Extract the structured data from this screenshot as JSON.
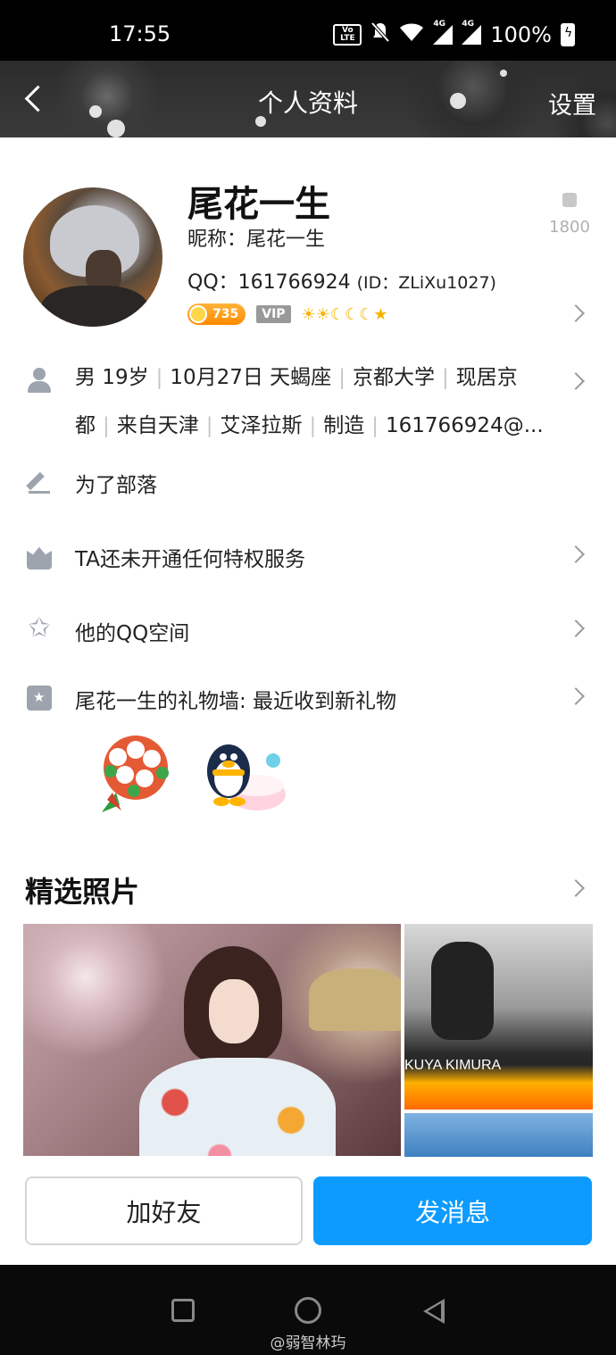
{
  "status_bar": {
    "time": "17:55",
    "volte_label": "Vo LTE",
    "network_1": "4G",
    "network_2": "4G",
    "battery": "100%"
  },
  "header": {
    "title": "个人资料",
    "settings_label": "设置"
  },
  "profile": {
    "display_name": "尾花一生",
    "nickname_line": "昵称：尾花一生",
    "qq_line": "QQ：161766924",
    "id_line": "(ID：ZLiXu1027)",
    "likes": "1800",
    "coin_level": "735",
    "vip_label": "VIP",
    "level_icons": "☀☀☾☾☾★"
  },
  "info": {
    "items": [
      "男",
      "19岁",
      "10月27日",
      "天蝎座",
      "京都大学",
      "现居京都",
      "来自天津",
      "艾泽拉斯",
      "制造",
      "161766924@..."
    ],
    "line1": [
      "男  19岁",
      "10月27日  天蝎座",
      "京都大学",
      "现居京"
    ],
    "line2": [
      "都",
      "来自天津",
      "艾泽拉斯",
      "制造",
      "161766924@..."
    ]
  },
  "rows": {
    "signature": "为了部落",
    "privilege": "TA还未开通任何特权服务",
    "qzone": "他的QQ空间",
    "gifts": "尾花一生的礼物墙: 最近收到新礼物"
  },
  "photos": {
    "section_title": "精选照片",
    "caption": "KUYA KIMURA"
  },
  "actions": {
    "add_friend": "加好友",
    "send_message": "发消息"
  },
  "watermark": "@弱智林玙",
  "colors": {
    "primary_button": "#0d9bff",
    "icon_gray": "#9ea4ad",
    "coin": "#ff8a00"
  }
}
